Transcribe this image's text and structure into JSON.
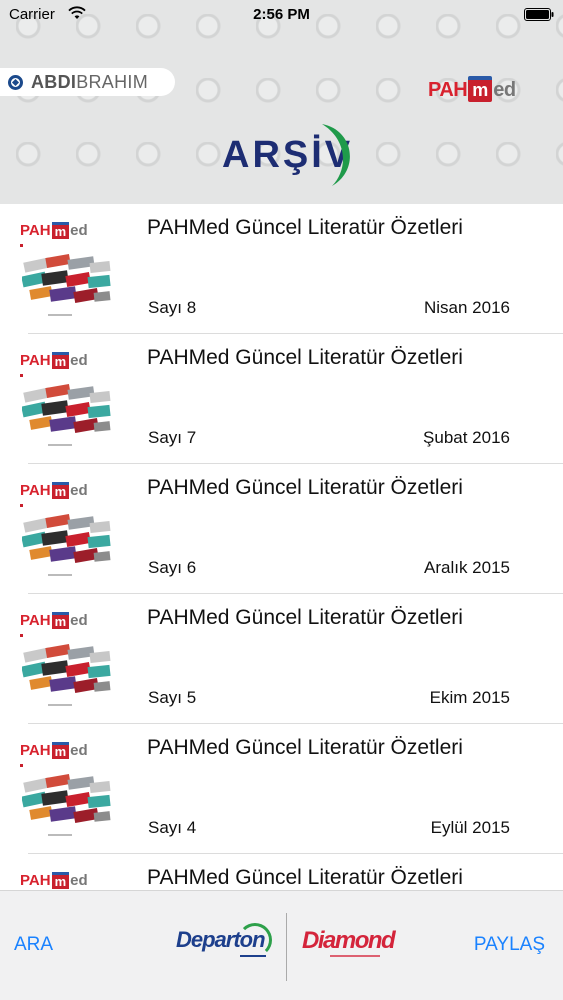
{
  "status_bar": {
    "carrier": "Carrier",
    "time": "2:56 PM"
  },
  "header": {
    "sponsor_logo_left": {
      "bold": "ABDI",
      "rest": "BRAHIM"
    },
    "app_logo": {
      "pah": "PAH",
      "m": "m",
      "ed": "ed"
    },
    "title": "ARŞİV",
    "colors": {
      "title": "#1d2d73",
      "swoosh": "#1f9a4a",
      "brand_red": "#d8222e",
      "brand_blue": "#2a5aa8"
    }
  },
  "list": {
    "items": [
      {
        "title": "PAHMed Güncel Literatür Özetleri",
        "issue": "Sayı 8",
        "date": "Nisan 2016"
      },
      {
        "title": "PAHMed Güncel Literatür Özetleri",
        "issue": "Sayı 7",
        "date": "Şubat 2016"
      },
      {
        "title": "PAHMed Güncel Literatür Özetleri",
        "issue": "Sayı 6",
        "date": "Aralık 2015"
      },
      {
        "title": "PAHMed Güncel Literatür Özetleri",
        "issue": "Sayı 5",
        "date": "Ekim 2015"
      },
      {
        "title": "PAHMed Güncel Literatür Özetleri",
        "issue": "Sayı 4",
        "date": "Eylül 2015"
      },
      {
        "title": "PAHMed Güncel Literatür Özetleri",
        "issue": "",
        "date": ""
      }
    ],
    "thumb_logo": {
      "pah": "PAH",
      "m": "m",
      "ed": "ed"
    }
  },
  "tabbar": {
    "left_button": "ARA",
    "right_button": "PAYLAŞ",
    "sponsor_1": "Departon",
    "sponsor_2": "Diamond",
    "accent": "#1a82ff"
  }
}
